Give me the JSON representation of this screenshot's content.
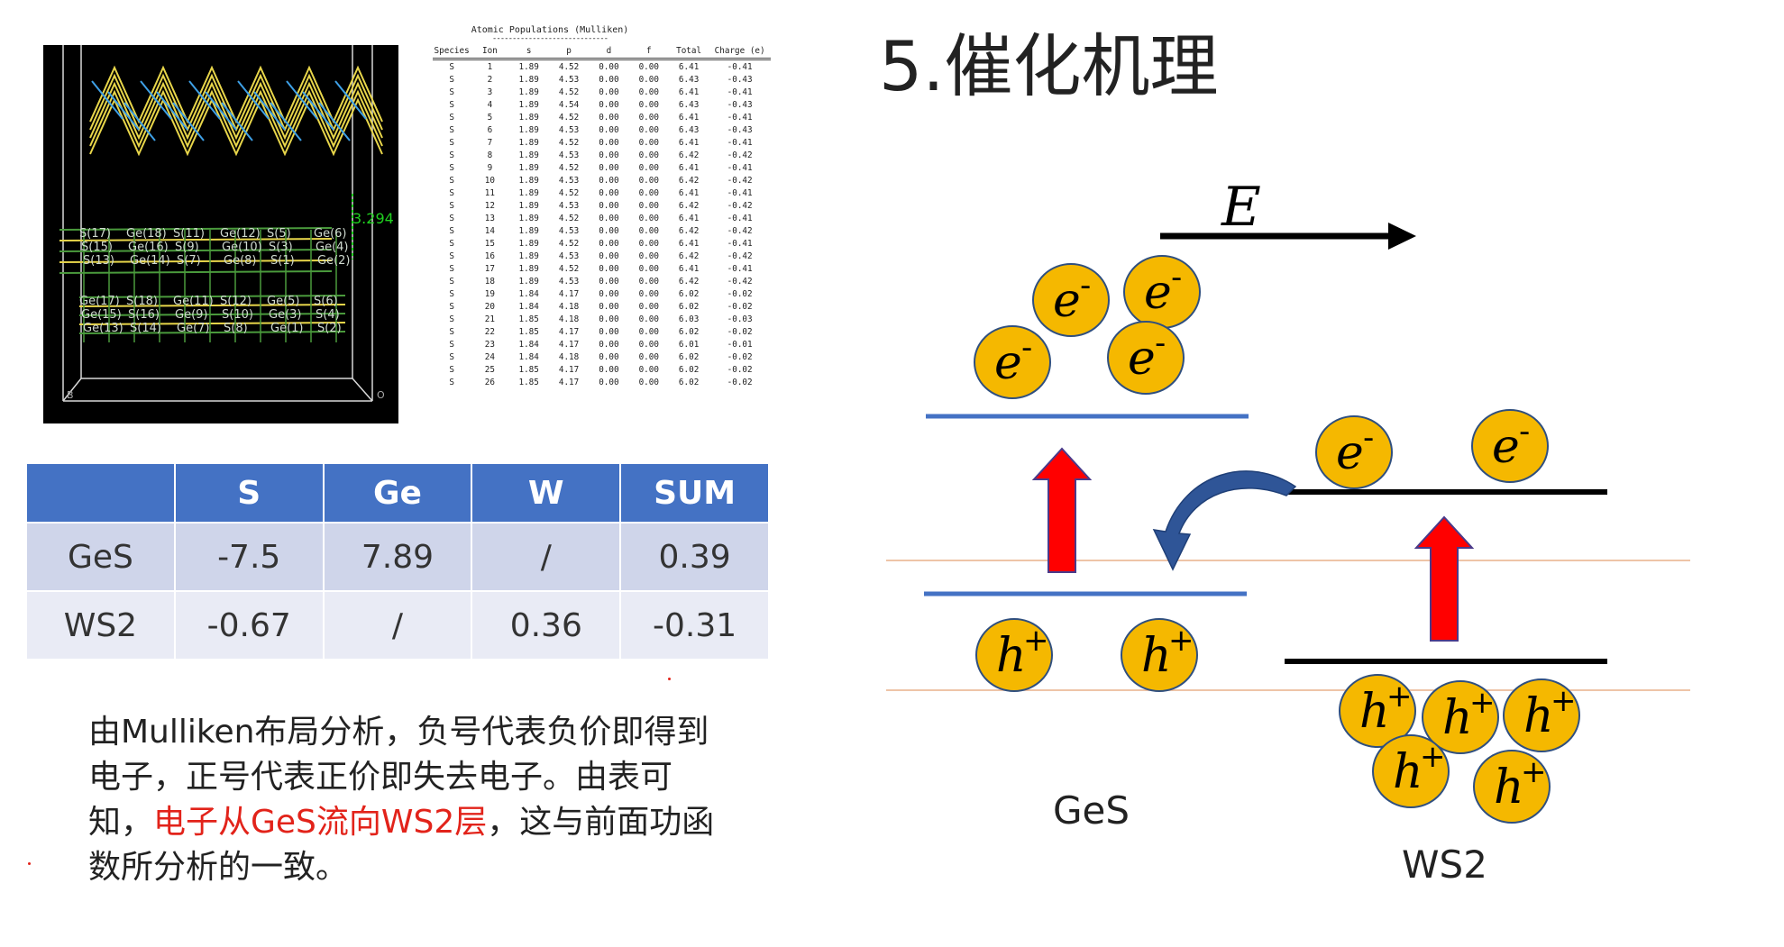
{
  "slide": {
    "title": "5.催化机理"
  },
  "structure_labels": [
    "S(17)",
    "S(15)",
    "S(13)",
    "Ge(18)",
    "Ge(16)",
    "Ge(14)",
    "S(11)",
    "S(9)",
    "S(7)",
    "Ge(12)",
    "Ge(10)",
    "Ge(8)",
    "S(5)",
    "S(3)",
    "S(1)",
    "Ge(6)",
    "Ge(4)",
    "Ge(2)",
    "Ge(17)",
    "Ge(15)",
    "Ge(13)",
    "S(18)",
    "S(16)",
    "S(14)",
    "Ge(11)",
    "Ge(9)",
    "Ge(7)",
    "S(12)",
    "S(10)",
    "S(8)",
    "Ge(5)",
    "Ge(3)",
    "Ge(1)",
    "S(6)",
    "S(4)",
    "S(2)"
  ],
  "structure_distance": "3.294",
  "atomic_populations": {
    "title": "Atomic Populations (Mulliken)",
    "dashes": "-----------------------------",
    "headers": [
      "Species",
      "Ion",
      "s",
      "p",
      "d",
      "f",
      "Total",
      "Charge (e)"
    ],
    "rows": [
      [
        "S",
        "1",
        "1.89",
        "4.52",
        "0.00",
        "0.00",
        "6.41",
        "-0.41"
      ],
      [
        "S",
        "2",
        "1.89",
        "4.53",
        "0.00",
        "0.00",
        "6.43",
        "-0.43"
      ],
      [
        "S",
        "3",
        "1.89",
        "4.52",
        "0.00",
        "0.00",
        "6.41",
        "-0.41"
      ],
      [
        "S",
        "4",
        "1.89",
        "4.54",
        "0.00",
        "0.00",
        "6.43",
        "-0.43"
      ],
      [
        "S",
        "5",
        "1.89",
        "4.52",
        "0.00",
        "0.00",
        "6.41",
        "-0.41"
      ],
      [
        "S",
        "6",
        "1.89",
        "4.53",
        "0.00",
        "0.00",
        "6.43",
        "-0.43"
      ],
      [
        "S",
        "7",
        "1.89",
        "4.52",
        "0.00",
        "0.00",
        "6.41",
        "-0.41"
      ],
      [
        "S",
        "8",
        "1.89",
        "4.53",
        "0.00",
        "0.00",
        "6.42",
        "-0.42"
      ],
      [
        "S",
        "9",
        "1.89",
        "4.52",
        "0.00",
        "0.00",
        "6.41",
        "-0.41"
      ],
      [
        "S",
        "10",
        "1.89",
        "4.53",
        "0.00",
        "0.00",
        "6.42",
        "-0.42"
      ],
      [
        "S",
        "11",
        "1.89",
        "4.52",
        "0.00",
        "0.00",
        "6.41",
        "-0.41"
      ],
      [
        "S",
        "12",
        "1.89",
        "4.53",
        "0.00",
        "0.00",
        "6.42",
        "-0.42"
      ],
      [
        "S",
        "13",
        "1.89",
        "4.52",
        "0.00",
        "0.00",
        "6.41",
        "-0.41"
      ],
      [
        "S",
        "14",
        "1.89",
        "4.53",
        "0.00",
        "0.00",
        "6.42",
        "-0.42"
      ],
      [
        "S",
        "15",
        "1.89",
        "4.52",
        "0.00",
        "0.00",
        "6.41",
        "-0.41"
      ],
      [
        "S",
        "16",
        "1.89",
        "4.53",
        "0.00",
        "0.00",
        "6.42",
        "-0.42"
      ],
      [
        "S",
        "17",
        "1.89",
        "4.52",
        "0.00",
        "0.00",
        "6.41",
        "-0.41"
      ],
      [
        "S",
        "18",
        "1.89",
        "4.53",
        "0.00",
        "0.00",
        "6.42",
        "-0.42"
      ],
      [
        "S",
        "19",
        "1.84",
        "4.17",
        "0.00",
        "0.00",
        "6.02",
        "-0.02"
      ],
      [
        "S",
        "20",
        "1.84",
        "4.18",
        "0.00",
        "0.00",
        "6.02",
        "-0.02"
      ],
      [
        "S",
        "21",
        "1.85",
        "4.18",
        "0.00",
        "0.00",
        "6.03",
        "-0.03"
      ],
      [
        "S",
        "22",
        "1.85",
        "4.17",
        "0.00",
        "0.00",
        "6.02",
        "-0.02"
      ],
      [
        "S",
        "23",
        "1.84",
        "4.17",
        "0.00",
        "0.00",
        "6.01",
        "-0.01"
      ],
      [
        "S",
        "24",
        "1.84",
        "4.18",
        "0.00",
        "0.00",
        "6.02",
        "-0.02"
      ],
      [
        "S",
        "25",
        "1.85",
        "4.17",
        "0.00",
        "0.00",
        "6.02",
        "-0.02"
      ],
      [
        "S",
        "26",
        "1.85",
        "4.17",
        "0.00",
        "0.00",
        "6.02",
        "-0.02"
      ]
    ]
  },
  "charge_table": {
    "headers": [
      "",
      "S",
      "Ge",
      "W",
      "SUM"
    ],
    "rows": [
      [
        "GeS",
        "-7.5",
        "7.89",
        "/",
        "0.39"
      ],
      [
        "WS2",
        "-0.67",
        "/",
        "0.36",
        "-0.31"
      ]
    ]
  },
  "paragraph": {
    "part1": "由Mulliken布局分析，负号代表负价即得到电子，正号代表正价即失去电子。由表可知，",
    "highlight": "电子从GeS流向WS2层",
    "part2": "，这与前面功函数所分析的一致。"
  },
  "diagram": {
    "field_label": "E",
    "electron_symbol": "e",
    "electron_sup": "-",
    "hole_symbol": "h",
    "hole_sup": "+",
    "ges_label": "GeS",
    "ws2_label": "WS2",
    "colors": {
      "particle_fill": "#f5b800",
      "particle_stroke": "#2f4f7f",
      "ges_band": "#4472c4",
      "ws2_band": "#000000",
      "arrow_up": "#ff0000",
      "curve_arrow": "#2f5597",
      "guide_line": "#e8b08a"
    }
  }
}
